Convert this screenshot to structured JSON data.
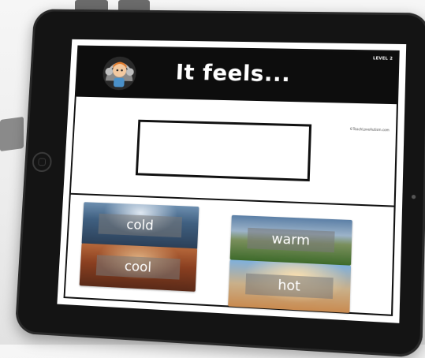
{
  "activity": {
    "title": "It feels...",
    "level": "LEVEL 2",
    "copyright": "©TeachLoveAutism.com"
  },
  "answer_box": {
    "value": ""
  },
  "choices": [
    {
      "label": "cold"
    },
    {
      "label": "cool"
    },
    {
      "label": "warm"
    },
    {
      "label": "hot"
    }
  ],
  "icons": {
    "avatar": "child-with-headphones-icon",
    "home": "home-button-icon"
  },
  "colors": {
    "tablet_bezel": "#141414",
    "header_bg": "#0d0d0d",
    "header_text": "#ffffff",
    "screen_bg": "#ffffff"
  }
}
